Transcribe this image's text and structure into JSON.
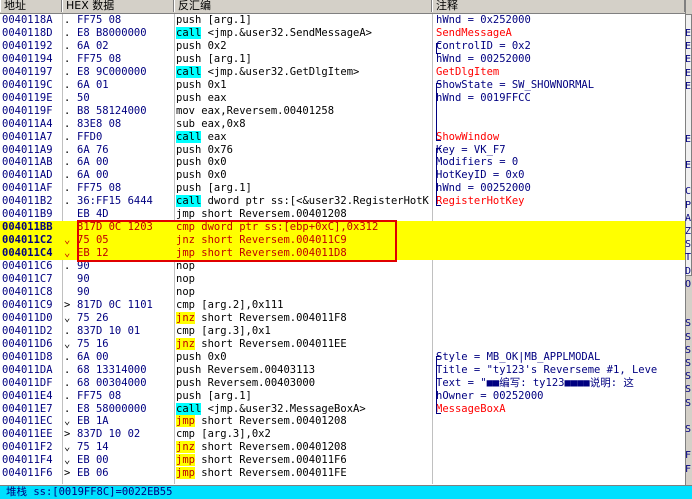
{
  "header": {
    "addr": "地址",
    "hex": "HEX 数据",
    "dis": "反汇编",
    "cmt": "注释"
  },
  "rows": [
    {
      "addr": "0040118A",
      "mk": ".",
      "hex": "FF75 08",
      "dis": [
        [
          "push [arg.1]",
          ""
        ]
      ],
      "cmt": [
        [
          "hWnd = 0x252000",
          ""
        ]
      ],
      "sel": false
    },
    {
      "addr": "0040118D",
      "mk": ".",
      "hex": "E8 B8000000",
      "dis": [
        [
          "call",
          "call"
        ],
        [
          " <jmp.&user32.SendMessageA>",
          ""
        ]
      ],
      "cmt": [
        [
          "SendMessageA",
          "red"
        ]
      ],
      "sel": false
    },
    {
      "addr": "00401192",
      "mk": ".",
      "hex": "6A 02",
      "dis": [
        [
          "push 0x2",
          ""
        ]
      ],
      "cmt": [
        [
          "ControlID = 0x2",
          ""
        ]
      ],
      "sel": false
    },
    {
      "addr": "00401194",
      "mk": ".",
      "hex": "FF75 08",
      "dis": [
        [
          "push [arg.1]",
          ""
        ]
      ],
      "cmt": [
        [
          "hWnd = 00252000",
          ""
        ]
      ],
      "sel": false
    },
    {
      "addr": "00401197",
      "mk": ".",
      "hex": "E8 9C000000",
      "dis": [
        [
          "call",
          "call"
        ],
        [
          " <jmp.&user32.GetDlgItem>",
          ""
        ]
      ],
      "cmt": [
        [
          "GetDlgItem",
          "red"
        ]
      ],
      "sel": false
    },
    {
      "addr": "0040119C",
      "mk": ".",
      "hex": "6A 01",
      "dis": [
        [
          "push 0x1",
          ""
        ]
      ],
      "cmt": [
        [
          "ShowState = SW_SHOWNORMAL",
          ""
        ]
      ],
      "sel": false
    },
    {
      "addr": "0040119E",
      "mk": ".",
      "hex": "50",
      "dis": [
        [
          "push eax",
          ""
        ]
      ],
      "cmt": [
        [
          "hWnd = 0019FFCC",
          ""
        ]
      ],
      "sel": false
    },
    {
      "addr": "0040119F",
      "mk": ".",
      "hex": "B8 58124000",
      "dis": [
        [
          "mov eax,Reversem.00401258",
          ""
        ]
      ],
      "cmt": [
        [
          "",
          ""
        ]
      ],
      "sel": false
    },
    {
      "addr": "004011A4",
      "mk": ".",
      "hex": "83E8 08",
      "dis": [
        [
          "sub eax,0x8",
          ""
        ]
      ],
      "cmt": [
        [
          "",
          ""
        ]
      ],
      "sel": false
    },
    {
      "addr": "004011A7",
      "mk": ".",
      "hex": "FFD0",
      "dis": [
        [
          "call",
          "call"
        ],
        [
          " eax",
          ""
        ]
      ],
      "cmt": [
        [
          "ShowWindow",
          "red"
        ]
      ],
      "sel": false
    },
    {
      "addr": "004011A9",
      "mk": ".",
      "hex": "6A 76",
      "dis": [
        [
          "push 0x76",
          ""
        ]
      ],
      "cmt": [
        [
          "Key = VK_F7",
          ""
        ]
      ],
      "sel": false
    },
    {
      "addr": "004011AB",
      "mk": ".",
      "hex": "6A 00",
      "dis": [
        [
          "push 0x0",
          ""
        ]
      ],
      "cmt": [
        [
          "Modifiers = 0",
          ""
        ]
      ],
      "sel": false
    },
    {
      "addr": "004011AD",
      "mk": ".",
      "hex": "6A 00",
      "dis": [
        [
          "push 0x0",
          ""
        ]
      ],
      "cmt": [
        [
          "HotKeyID = 0x0",
          ""
        ]
      ],
      "sel": false
    },
    {
      "addr": "004011AF",
      "mk": ".",
      "hex": "FF75 08",
      "dis": [
        [
          "push [arg.1]",
          ""
        ]
      ],
      "cmt": [
        [
          "hWnd = 00252000",
          ""
        ]
      ],
      "sel": false
    },
    {
      "addr": "004011B2",
      "mk": ".",
      "hex": "36:FF15 6444",
      "dis": [
        [
          "call",
          "call"
        ],
        [
          " dword ptr ss:[<&user32.RegisterHotK",
          ""
        ]
      ],
      "cmt": [
        [
          "RegisterHotKey",
          "red"
        ]
      ],
      "sel": false
    },
    {
      "addr": "004011B9",
      "mk": "",
      "hex": "EB 4D",
      "dis": [
        [
          "jmp short Reversem.00401208",
          ""
        ]
      ],
      "cmt": [
        [
          "",
          ""
        ]
      ],
      "sel": false
    },
    {
      "addr": "004011BB",
      "mk": "",
      "hex": "817D 0C 1203",
      "dis": [
        [
          "cmp dword ptr ss:[ebp+0xC],0x312",
          ""
        ]
      ],
      "cmt": [
        [
          "",
          ""
        ]
      ],
      "sel": true
    },
    {
      "addr": "004011C2",
      "mk": "⌄",
      "hex": "75 05",
      "dis": [
        [
          "jnz short Reversem.004011C9",
          ""
        ]
      ],
      "cmt": [
        [
          "",
          ""
        ]
      ],
      "sel": true
    },
    {
      "addr": "004011C4",
      "mk": "⌄",
      "hex": "EB 12",
      "dis": [
        [
          "jmp short Reversem.004011D8",
          ""
        ]
      ],
      "cmt": [
        [
          "",
          ""
        ]
      ],
      "sel": true
    },
    {
      "addr": "004011C6",
      "mk": ".",
      "hex": "90",
      "dis": [
        [
          "nop",
          ""
        ]
      ],
      "cmt": [
        [
          "",
          ""
        ]
      ],
      "sel": false
    },
    {
      "addr": "004011C7",
      "mk": "",
      "hex": "90",
      "dis": [
        [
          "nop",
          ""
        ]
      ],
      "cmt": [
        [
          "",
          ""
        ]
      ],
      "sel": false
    },
    {
      "addr": "004011C8",
      "mk": "",
      "hex": "90",
      "dis": [
        [
          "nop",
          ""
        ]
      ],
      "cmt": [
        [
          "",
          ""
        ]
      ],
      "sel": false
    },
    {
      "addr": "004011C9",
      "mk": ">",
      "hex": "817D 0C 1101",
      "dis": [
        [
          "cmp [arg.2],0x111",
          ""
        ]
      ],
      "cmt": [
        [
          "",
          ""
        ]
      ],
      "sel": false
    },
    {
      "addr": "004011D0",
      "mk": "⌄",
      "hex": "75 26",
      "dis": [
        [
          "jnz",
          "jmp"
        ],
        [
          " short Reversem.004011F8",
          ""
        ]
      ],
      "cmt": [
        [
          "",
          ""
        ]
      ],
      "sel": false
    },
    {
      "addr": "004011D2",
      "mk": ".",
      "hex": "837D 10 01",
      "dis": [
        [
          "cmp [arg.3],0x1",
          ""
        ]
      ],
      "cmt": [
        [
          "",
          ""
        ]
      ],
      "sel": false
    },
    {
      "addr": "004011D6",
      "mk": "⌄",
      "hex": "75 16",
      "dis": [
        [
          "jnz",
          "jmp"
        ],
        [
          " short Reversem.004011EE",
          ""
        ]
      ],
      "cmt": [
        [
          "",
          ""
        ]
      ],
      "sel": false
    },
    {
      "addr": "004011D8",
      "mk": ".",
      "hex": "6A 00",
      "dis": [
        [
          "push 0x0",
          ""
        ]
      ],
      "cmt": [
        [
          "Style = MB_OK|MB_APPLMODAL",
          ""
        ]
      ],
      "sel": false
    },
    {
      "addr": "004011DA",
      "mk": ".",
      "hex": "68 13314000",
      "dis": [
        [
          "push Reversem.00403113",
          ""
        ]
      ],
      "cmt": [
        [
          "Title = \"ty123's Reverseme #1, Leve",
          ""
        ]
      ],
      "sel": false
    },
    {
      "addr": "004011DF",
      "mk": ".",
      "hex": "68 00304000",
      "dis": [
        [
          "push Reversem.00403000",
          ""
        ]
      ],
      "cmt": [
        [
          "Text = \"■■编写: ty123■■■■说明: 这",
          ""
        ]
      ],
      "sel": false
    },
    {
      "addr": "004011E4",
      "mk": ".",
      "hex": "FF75 08",
      "dis": [
        [
          "push [arg.1]",
          ""
        ]
      ],
      "cmt": [
        [
          "hOwner = 00252000",
          ""
        ]
      ],
      "sel": false
    },
    {
      "addr": "004011E7",
      "mk": ".",
      "hex": "E8 58000000",
      "dis": [
        [
          "call",
          "call"
        ],
        [
          " <jmp.&user32.MessageBoxA>",
          ""
        ]
      ],
      "cmt": [
        [
          "MessageBoxA",
          "red"
        ]
      ],
      "sel": false
    },
    {
      "addr": "004011EC",
      "mk": "⌄",
      "hex": "EB 1A",
      "dis": [
        [
          "jmp",
          "jmp"
        ],
        [
          " short Reversem.00401208",
          ""
        ]
      ],
      "cmt": [
        [
          "",
          ""
        ]
      ],
      "sel": false
    },
    {
      "addr": "004011EE",
      "mk": ">",
      "hex": "837D 10 02",
      "dis": [
        [
          "cmp [arg.3],0x2",
          ""
        ]
      ],
      "cmt": [
        [
          "",
          ""
        ]
      ],
      "sel": false
    },
    {
      "addr": "004011F2",
      "mk": "⌄",
      "hex": "75 14",
      "dis": [
        [
          "jnz",
          "jmp"
        ],
        [
          " short Reversem.00401208",
          ""
        ]
      ],
      "cmt": [
        [
          "",
          ""
        ]
      ],
      "sel": false
    },
    {
      "addr": "004011F4",
      "mk": "⌄",
      "hex": "EB 00",
      "dis": [
        [
          "jmp",
          "jmp"
        ],
        [
          " short Reversem.004011F6",
          ""
        ]
      ],
      "cmt": [
        [
          "",
          ""
        ]
      ],
      "sel": false
    },
    {
      "addr": "004011F6",
      "mk": ">",
      "hex": "EB 06",
      "dis": [
        [
          "jmp",
          "jmp"
        ],
        [
          " short Reversem.004011FE",
          ""
        ]
      ],
      "cmt": [
        [
          "",
          ""
        ]
      ],
      "sel": false
    }
  ],
  "right_pane": [
    "E",
    "E",
    "E",
    "E",
    "E",
    "",
    "",
    "",
    "E",
    "",
    "E",
    "",
    "C",
    "P",
    "A",
    "Z",
    "S",
    "T",
    "D",
    "O",
    "",
    "",
    "S",
    "S",
    "S",
    "S",
    "S",
    "S",
    "S",
    "",
    "S",
    "",
    "F",
    "F"
  ],
  "status": "堆栈 ss:[0019FF8C]=0022EB55"
}
